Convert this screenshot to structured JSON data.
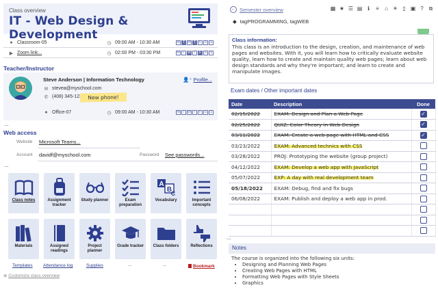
{
  "class": {
    "overview_label": "Class overview",
    "title": "IT - Web Design & Development",
    "room": "Classroom-05",
    "zoom": "Zoom link...",
    "time1": "09:00 AM - 10:30 AM",
    "time2": "02:00 PM - 03:30 PM",
    "days": [
      "M",
      "T",
      "W",
      "T",
      "F",
      "S",
      "S"
    ]
  },
  "teacher": {
    "section": "Teacher/Instructor",
    "name": "Steve Anderson | Information Technology",
    "email": "stevea@myschool.com",
    "phone": "(408) 345-1234",
    "sticky": "New phone!",
    "office": "Office-07",
    "time": "09:00 AM - 10:30 AM",
    "profile": "Profile..."
  },
  "web": {
    "section": "Web access",
    "website_label": "Website",
    "website_value": "Microsoft Teams...",
    "account_label": "Account",
    "account_value": "davidf@myschool.com",
    "password_label": "Password",
    "password_value": "See passwords..."
  },
  "tiles": [
    {
      "label": "Class notes",
      "icon": "book-icon",
      "underline": true
    },
    {
      "label": "Assignment tracker",
      "icon": "backpack-icon"
    },
    {
      "label": "Study planner",
      "icon": "glasses-icon"
    },
    {
      "label": "Exam preparation",
      "icon": "checklist-icon"
    },
    {
      "label": "Vocabulary",
      "icon": "abc-icon"
    },
    {
      "label": "Important concepts",
      "icon": "list-icon"
    },
    {
      "label": "Materials",
      "icon": "books-icon"
    },
    {
      "label": "Assigned readings",
      "icon": "notebook-icon"
    },
    {
      "label": "Project planner",
      "icon": "gear-icon"
    },
    {
      "label": "Grade tracker",
      "icon": "graduation-cap-icon"
    },
    {
      "label": "Class folders",
      "icon": "folder-icon"
    },
    {
      "label": "Reflections",
      "icon": "thumbs-icon"
    }
  ],
  "bottom_links": [
    "Templates",
    "Attendance log",
    "Supplies",
    "...",
    "...",
    "Bookmark"
  ],
  "customize": "Customize class overview",
  "right": {
    "semester": "Semester overview",
    "tags": "tagPROGRAMMING, tagWEB",
    "info_title": "Class information:",
    "info_body": "This class is an introduction to the design, creation, and maintenance of web pages and websites. With it, you will learn how to critically evaluate website quality, learn how to create and maintain quality web pages; learn about web design standards and why they're important; and learn to create and manipulate images.",
    "tab_exam": "Exam dates",
    "tab_sep": " / ",
    "tab_other": "Other important dates",
    "col_date": "Date",
    "col_desc": "Description",
    "col_done": "Done",
    "notes_title": "Notes",
    "notes_intro": "The course is organized into the following six units:",
    "notes_items": [
      "Designing and Planning Web Pages",
      "Creating Web Pages with HTML",
      "Formatting Web Pages with Style Sheets",
      "Graphics"
    ]
  },
  "exams": [
    {
      "date": "02/15/2022",
      "desc": "EXAM: Design and Plan a Web Page",
      "done": true,
      "strike": true
    },
    {
      "date": "02/25/2022",
      "desc": "QUIZ: Color Theory in Web Design",
      "done": true,
      "strike": true
    },
    {
      "date": "03/11/2022",
      "desc": "EXAM: Create a web page with HTML and CSS",
      "done": true,
      "strike": true
    },
    {
      "date": "03/23/2022",
      "desc": "EXAM: Advanced technics with CSS",
      "done": false,
      "highlight": true
    },
    {
      "date": "03/28/2022",
      "desc": "PROJ: Prototyping the website (group project)",
      "done": false
    },
    {
      "date": "04/12/2022",
      "desc": "EXAM: Develop a web app with JavaScript",
      "done": false,
      "highlight": true
    },
    {
      "date": "05/07/2022",
      "desc": "EXP: A day with real development team",
      "done": false,
      "highlight": true
    },
    {
      "date": "05/18/2022",
      "desc": "EXAM: Debug, find and fix bugs",
      "done": false,
      "bold_date": true
    },
    {
      "date": "06/08/2022",
      "desc": "EXAM: Publish and deploy a web app in prod.",
      "done": false
    },
    {
      "date": "",
      "desc": "",
      "done": false
    },
    {
      "date": "",
      "desc": "",
      "done": false
    },
    {
      "date": "",
      "desc": "",
      "done": false
    }
  ]
}
